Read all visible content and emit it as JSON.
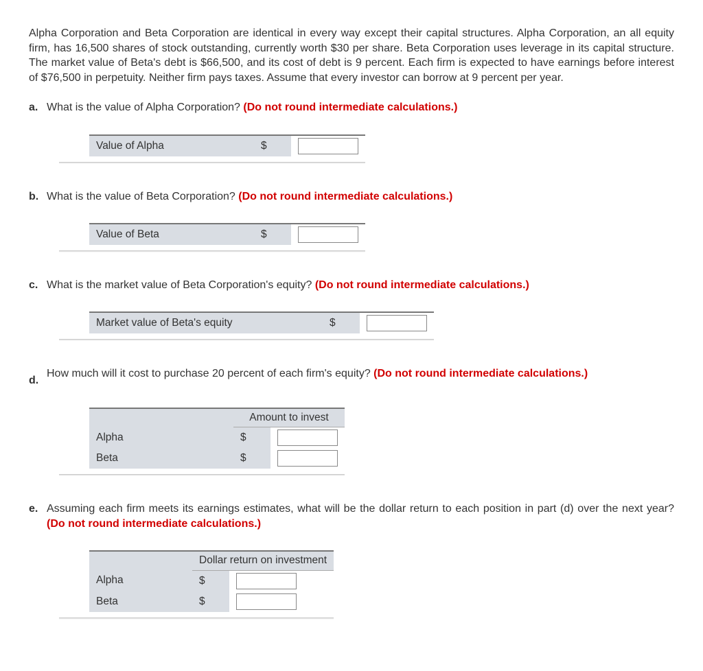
{
  "intro": "Alpha Corporation and Beta Corporation are identical in every way except their capital structures. Alpha Corporation, an all equity firm, has 16,500 shares of stock outstanding, currently worth $30 per share. Beta Corporation uses leverage in its capital structure. The market value of Beta's debt is $66,500, and its cost of debt is 9 percent. Each firm is expected to have earnings before interest of $76,500 in perpetuity. Neither firm pays taxes. Assume that every investor can borrow at 9 percent per year.",
  "questions": {
    "a": {
      "letter": "a.",
      "text": "What is the value of Alpha Corporation? ",
      "instruct": "(Do not round intermediate calculations.)",
      "row_label": "Value of Alpha",
      "currency": "$"
    },
    "b": {
      "letter": "b.",
      "text": "What is the value of Beta Corporation? ",
      "instruct": "(Do not round intermediate calculations.)",
      "row_label": "Value of Beta",
      "currency": "$"
    },
    "c": {
      "letter": "c.",
      "text": "What is the market value of Beta Corporation's equity? ",
      "instruct": "(Do not round intermediate calculations.)",
      "row_label": "Market value of Beta's equity",
      "currency": "$"
    },
    "d": {
      "letter": "d.",
      "text": "How much will it cost to purchase 20 percent of each firm's equity? ",
      "instruct": "(Do not round intermediate calculations.)",
      "header": "Amount to invest",
      "row1": "Alpha",
      "row2": "Beta",
      "currency": "$"
    },
    "e": {
      "letter": "e.",
      "text": "Assuming each firm meets its earnings estimates, what will be the dollar return to each position in part (d) over the next year? ",
      "instruct": "(Do not round intermediate calculations.)",
      "header": "Dollar return on investment",
      "row1": "Alpha",
      "row2": "Beta",
      "currency": "$"
    }
  }
}
